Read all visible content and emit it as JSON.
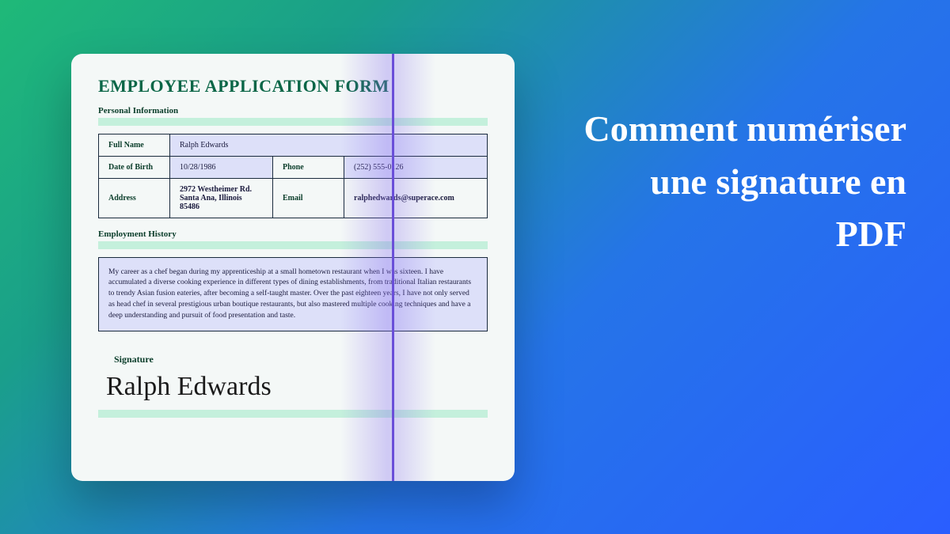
{
  "headline": "Comment numériser une signature en PDF",
  "document": {
    "title": "EMPLOYEE APPLICATION FORM",
    "section1": "Personal Information",
    "fields": {
      "fullname_label": "Full Name",
      "fullname_value": "Ralph Edwards",
      "dob_label": "Date of Birth",
      "dob_value": "10/28/1986",
      "phone_label": "Phone",
      "phone_value": "(252) 555-0126",
      "address_label": "Address",
      "address_line1": "2972 Westheimer Rd.",
      "address_line2": "Santa Ana, Illinois 85486",
      "email_label": "Email",
      "email_value": "ralphedwards@superace.com"
    },
    "section2": "Employment History",
    "history_text": "My career as a chef began during my apprenticeship at a small hometown restaurant when I was sixteen. I have accumulated a diverse cooking experience in different types of dining establishments, from traditional Italian restaurants to trendy Asian fusion eateries, after becoming a self-taught master. Over the past eighteen years, I have not only served as head chef in several prestigious urban boutique restaurants, but also mastered multiple cooking techniques and have a deep understanding and pursuit of food presentation and taste.",
    "signature_label": "Signature",
    "signature_value": "Ralph Edwards"
  }
}
